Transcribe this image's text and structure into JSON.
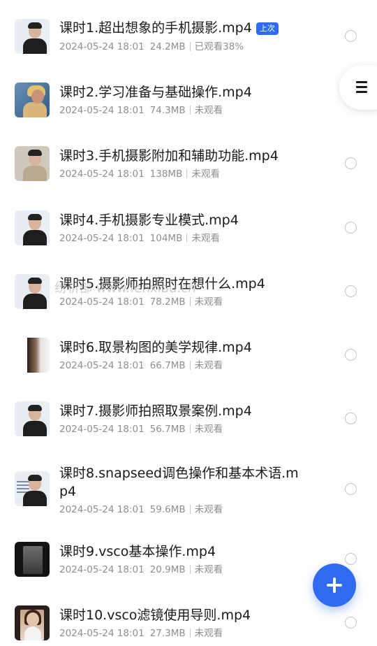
{
  "lessons": [
    {
      "title": "课时1.超出想象的手机摄影.mp4",
      "badge": "上次",
      "date": "2024-05-24 18:01",
      "size": "24.2MB",
      "status": "已观看38%"
    },
    {
      "title": "课时2.学习准备与基础操作.mp4",
      "date": "2024-05-24 18:01",
      "size": "74.3MB",
      "status": "未观看"
    },
    {
      "title": "课时3.手机摄影附加和辅助功能.mp4",
      "date": "2024-05-24 18:01",
      "size": "138MB",
      "status": "未观看"
    },
    {
      "title": "课时4.手机摄影专业模式.mp4",
      "date": "2024-05-24 18:01",
      "size": "104MB",
      "status": "未观看"
    },
    {
      "title": "课时5.摄影师拍照时在想什么.mp4",
      "date": "2024-05-24 18:01",
      "size": "78.2MB",
      "status": "未观看"
    },
    {
      "title": "课时6.取景构图的美学规律.mp4",
      "date": "2024-05-24 18:01",
      "size": "66.7MB",
      "status": "未观看"
    },
    {
      "title": "课时7.摄影师拍照取景案例.mp4",
      "date": "2024-05-24 18:01",
      "size": "56.7MB",
      "status": "未观看"
    },
    {
      "title": "课时8.snapseed调色操作和基本术语.mp4",
      "date": "2024-05-24 18:01",
      "size": "59.6MB",
      "status": "未观看"
    },
    {
      "title": "课时9.vsco基本操作.mp4",
      "date": "2024-05-24 18:01",
      "size": "20.9MB",
      "status": "未观看"
    },
    {
      "title": "课时10.vsco滤镜使用导则.mp4",
      "date": "2024-05-24 18:01",
      "size": "27.3MB",
      "status": "未观看"
    }
  ],
  "watermark": "纷析部 www.fenxibu.cn",
  "icons": {
    "menu": "hamburger-menu-icon",
    "add": "plus-icon",
    "select": "radio-circle-icon"
  },
  "colors": {
    "accent": "#2f6bf0",
    "meta_text": "#8e8e93",
    "title_text": "#1a1a1a"
  }
}
